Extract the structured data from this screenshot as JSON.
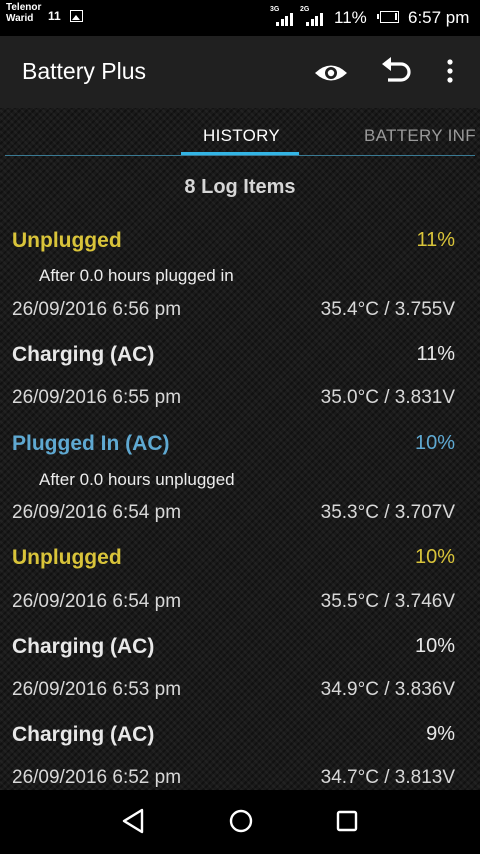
{
  "status_bar": {
    "carrier_1": "Telenor",
    "carrier_2": "Warid",
    "notification_count": "11",
    "network_1": "3G",
    "network_2": "2G",
    "battery_percent": "11%",
    "time": "6:57 pm"
  },
  "app_bar": {
    "title": "Battery Plus",
    "icons": [
      "eye-icon",
      "undo-icon",
      "more-vert-icon"
    ]
  },
  "tabs": [
    {
      "label": "HISTORY",
      "selected": true
    },
    {
      "label": "BATTERY INF",
      "selected": false
    }
  ],
  "colors": {
    "unplugged": "#d9c43a",
    "plugged_in": "#5fa9d2",
    "charging": "#e8e8e8",
    "tab_indicator": "#33b5e5"
  },
  "log": {
    "count_label": "8 Log Items",
    "entries": [
      {
        "type": "Unplugged",
        "percent": "11%",
        "note": "After 0.0 hours plugged in",
        "datetime": "26/09/2016  6:56 pm",
        "reading": "35.4°C / 3.755V"
      },
      {
        "type": "Charging (AC)",
        "percent": "11%",
        "datetime": "26/09/2016  6:55 pm",
        "reading": "35.0°C / 3.831V"
      },
      {
        "type": "Plugged In (AC)",
        "percent": "10%",
        "note": "After 0.0 hours unplugged",
        "datetime": "26/09/2016  6:54 pm",
        "reading": "35.3°C / 3.707V"
      },
      {
        "type": "Unplugged",
        "percent": "10%",
        "datetime": "26/09/2016  6:54 pm",
        "reading": "35.5°C / 3.746V"
      },
      {
        "type": "Charging (AC)",
        "percent": "10%",
        "datetime": "26/09/2016  6:53 pm",
        "reading": "34.9°C / 3.836V"
      },
      {
        "type": "Charging (AC)",
        "percent": "9%",
        "datetime": "26/09/2016  6:52 pm",
        "reading": "34.7°C / 3.813V"
      }
    ]
  },
  "nav_bar": {
    "icons": [
      "back-icon",
      "home-icon",
      "recents-icon"
    ]
  }
}
